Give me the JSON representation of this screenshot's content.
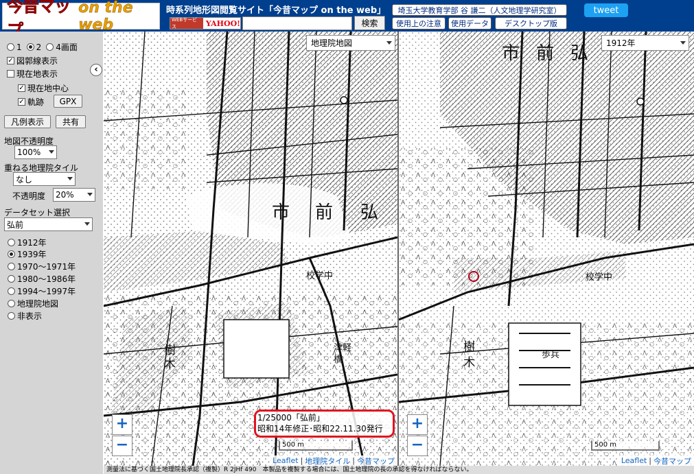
{
  "header": {
    "logo_main": "今昔マップ",
    "logo_sub": "on the web",
    "site_title": "時系列地形図閲覧サイト「今昔マップ on the web」",
    "yahoo_badge_prefix": "WEBサービス",
    "yahoo_badge_label": "YAHOO!",
    "search_value": "",
    "search_button": "検索",
    "univ_link": "埼玉大学教育学部 谷 謙二（人文地理学研究室）",
    "notes_link": "使用上の注意",
    "data_link": "使用データ",
    "desktop_link": "デスクトップ版",
    "tweet_label": "tweet"
  },
  "sidebar": {
    "collapse_icon": "‹",
    "screen_modes": [
      {
        "label": "1",
        "selected": false
      },
      {
        "label": "2",
        "selected": true
      },
      {
        "label": "4画面",
        "selected": false
      }
    ],
    "grid_lines": {
      "label": "図郭線表示",
      "checked": true
    },
    "current_location": {
      "label": "現在地表示",
      "checked": false
    },
    "center_current": {
      "label": "現在地中心",
      "checked": true
    },
    "track": {
      "label": "軌跡",
      "checked": true
    },
    "gpx_button": "GPX",
    "legend_button": "凡例表示",
    "share_button": "共有",
    "opacity_label": "地図不透明度",
    "opacity_value": "100%",
    "overlay_label": "重ねる地理院タイル",
    "overlay_value": "なし",
    "overlay_opacity_label": "不透明度",
    "overlay_opacity_value": "20%",
    "dataset_label": "データセット選択",
    "dataset_value": "弘前",
    "periods": [
      {
        "label": "1912年",
        "selected": false
      },
      {
        "label": "1939年",
        "selected": true
      },
      {
        "label": "1970～1971年",
        "selected": false
      },
      {
        "label": "1980～1986年",
        "selected": false
      },
      {
        "label": "1994～1997年",
        "selected": false
      },
      {
        "label": "地理院地図",
        "selected": false
      },
      {
        "label": "非表示",
        "selected": false
      }
    ]
  },
  "map_left": {
    "layer_select": "地理院地図",
    "zoom_in": "+",
    "zoom_out": "−",
    "scale_label": "500 m",
    "info_line1": "1/25000「弘前」",
    "info_line2": "昭和14年修正･昭和22.11.30発行",
    "labels": {
      "a": "市",
      "b": "前",
      "c": "弘",
      "d": "樹",
      "e": "木",
      "f": "校学中",
      "g": "橋",
      "h": "津軽"
    },
    "attribution": [
      "Leaflet",
      "地理院タイル",
      "今昔マップ"
    ],
    "attribution_sep": "|"
  },
  "map_right": {
    "layer_select": "1912年",
    "zoom_in": "+",
    "zoom_out": "−",
    "scale_label": "500 m",
    "labels": {
      "a": "市",
      "b": "前",
      "c": "弘",
      "d": "樹",
      "e": "木",
      "f": "校学中",
      "g": "歩兵"
    },
    "attribution": [
      "Leaflet",
      "今昔マップ"
    ],
    "attribution_sep": "|"
  },
  "footer": {
    "text": "測量法に基づく国土地理院長承認（複製）R 2JHf 490　本製品を複製する場合には、国土地理院の長の承認を得なければならない。"
  },
  "colors": {
    "header_bg": "#003f8e",
    "tweet_bg": "#1da1f2",
    "highlight": "#e0141e",
    "sidebar_bg": "#d5d5d5"
  }
}
